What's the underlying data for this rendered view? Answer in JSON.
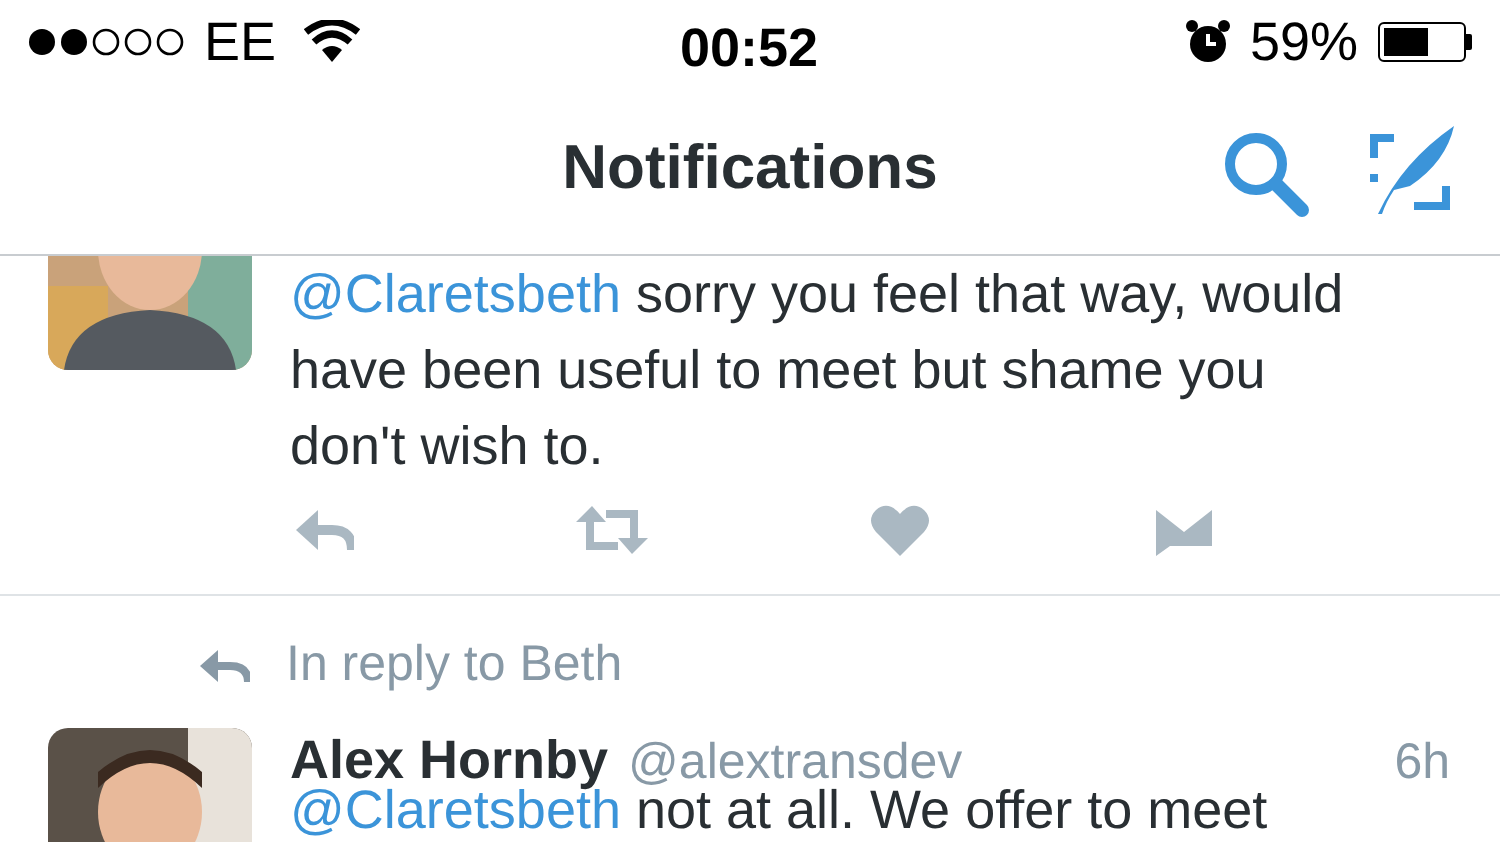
{
  "status_bar": {
    "carrier": "EE",
    "time": "00:52",
    "battery_text": "59%"
  },
  "nav_bar": {
    "title": "Notifications"
  },
  "tweets": [
    {
      "mention": "@Claretsbeth",
      "text": " sorry you feel that way, would have been useful to meet but shame you don't wish to.",
      "actions": true
    },
    {
      "in_reply_to": "In reply to Beth",
      "name": "Alex Hornby",
      "handle": "@alextransdev",
      "time": "6h",
      "mention": "@Claretsbeth",
      "text": " not at all. We offer to meet",
      "actions": false
    }
  ]
}
